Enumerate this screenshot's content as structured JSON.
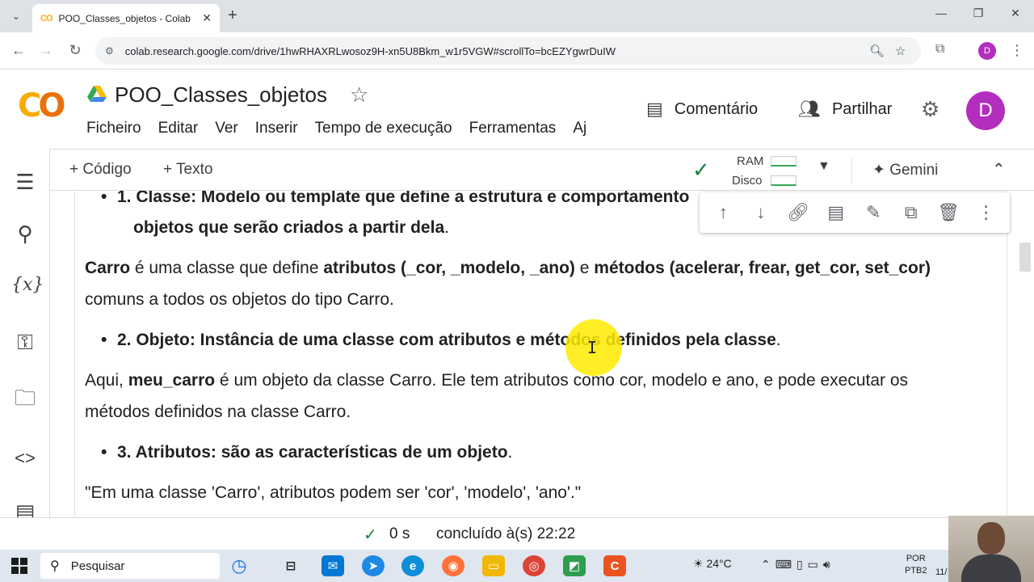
{
  "browser": {
    "tab_title": "POO_Classes_objetos - Colab",
    "tab_favicon": "CO",
    "url": "colab.research.google.com/drive/1hwRHAXRLwosoz9H-xn5U8Bkm_w1r5VGW#scrollTo=bcEZYgwrDuIW",
    "profile_initial": "D"
  },
  "colab": {
    "title": "POO_Classes_objetos",
    "menu": [
      "Ficheiro",
      "Editar",
      "Ver",
      "Inserir",
      "Tempo de execução",
      "Ferramentas",
      "Aj"
    ],
    "comment_label": "Comentário",
    "share_label": "Partilhar",
    "avatar_initial": "D",
    "accent_color": "#f9ab00"
  },
  "toolbar": {
    "add_code": "+ Código",
    "add_text": "+ Texto",
    "ram_label": "RAM",
    "disk_label": "Disco",
    "gemini_label": "Gemini"
  },
  "content": {
    "p1_bold": "1. Classe: Modelo ou template que define a estrutura e comportamento",
    "p1_line2_bold": "objetos que serão criados a partir dela",
    "p1_line2_end": ".",
    "p2_carro": "Carro",
    "p2_t1": " é uma classe que define ",
    "p2_attrs": "atributos (_cor, _modelo, _ano)",
    "p2_t2": " e ",
    "p2_methods": "métodos (acelerar, frear, get_cor, set_cor)",
    "p2_line2": "comuns a todos os objetos do tipo Carro.",
    "b2_bold": "2. Objeto: Instância de uma classe com atributos e métodos definidos pela classe",
    "b2_end": ".",
    "p3_t1": "Aqui, ",
    "p3_bold": "meu_carro",
    "p3_t2": " é um objeto da classe Carro. Ele tem atributos como cor, modelo e ano, e pode executar os",
    "p3_line2": "métodos definidos na classe Carro.",
    "b3_bold": "3. Atributos: são as características de um objeto",
    "b3_end": ".",
    "p4": "\"Em uma classe 'Carro', atributos podem ser 'cor', 'modelo', 'ano'.\""
  },
  "status": {
    "duration": "0 s",
    "done": "concluído à(s) 22:22"
  },
  "taskbar": {
    "search_placeholder": "Pesquisar",
    "weather": "24°C",
    "lang_line1": "POR",
    "lang_line2": "PTB2",
    "clock_partial": "11/"
  }
}
